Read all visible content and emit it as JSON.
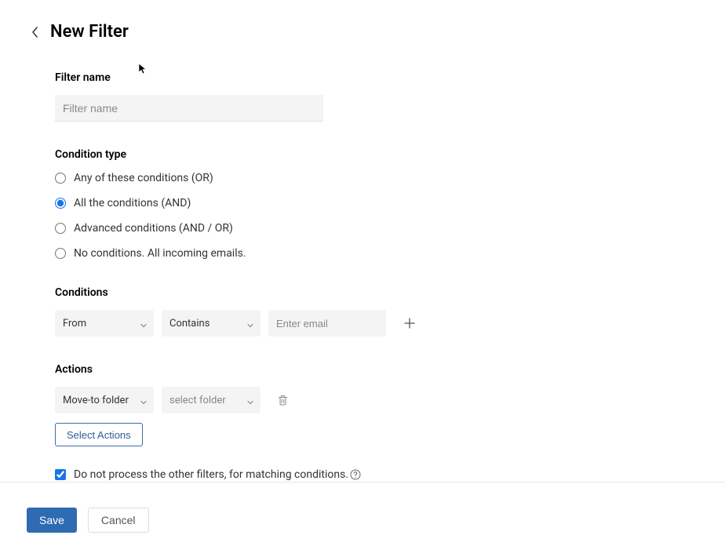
{
  "header": {
    "title": "New Filter"
  },
  "filter_name": {
    "label": "Filter name",
    "placeholder": "Filter name",
    "value": ""
  },
  "condition_type": {
    "label": "Condition type",
    "options": [
      "Any of these conditions (OR)",
      "All the conditions (AND)",
      "Advanced conditions (AND / OR)",
      "No conditions. All incoming emails."
    ],
    "selected_index": 1
  },
  "conditions": {
    "label": "Conditions",
    "field_select": "From",
    "operator_select": "Contains",
    "value_placeholder": "Enter email",
    "value": ""
  },
  "actions": {
    "label": "Actions",
    "action_select": "Move-to folder",
    "target_select": "select folder",
    "select_actions_label": "Select Actions"
  },
  "stop_processing": {
    "label": "Do not process the other filters, for matching conditions.",
    "checked": true
  },
  "footer": {
    "save_label": "Save",
    "cancel_label": "Cancel"
  }
}
